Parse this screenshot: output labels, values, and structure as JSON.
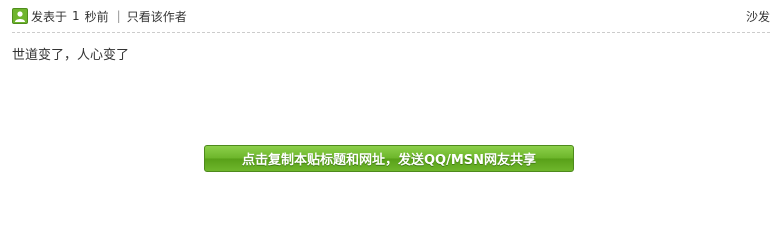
{
  "post": {
    "posted_label": "发表于",
    "time_value": "1",
    "time_unit": "秒前",
    "separator": "|",
    "only_author_label": "只看该作者",
    "floor_label": "沙发",
    "content": "世道变了，人心变了"
  },
  "share": {
    "button_label": "点击复制本贴标题和网址，发送QQ/MSN网友共享"
  },
  "colors": {
    "accent_green": "#6cb52a",
    "divider": "#cccccc"
  },
  "icons": {
    "author": "user-icon"
  }
}
